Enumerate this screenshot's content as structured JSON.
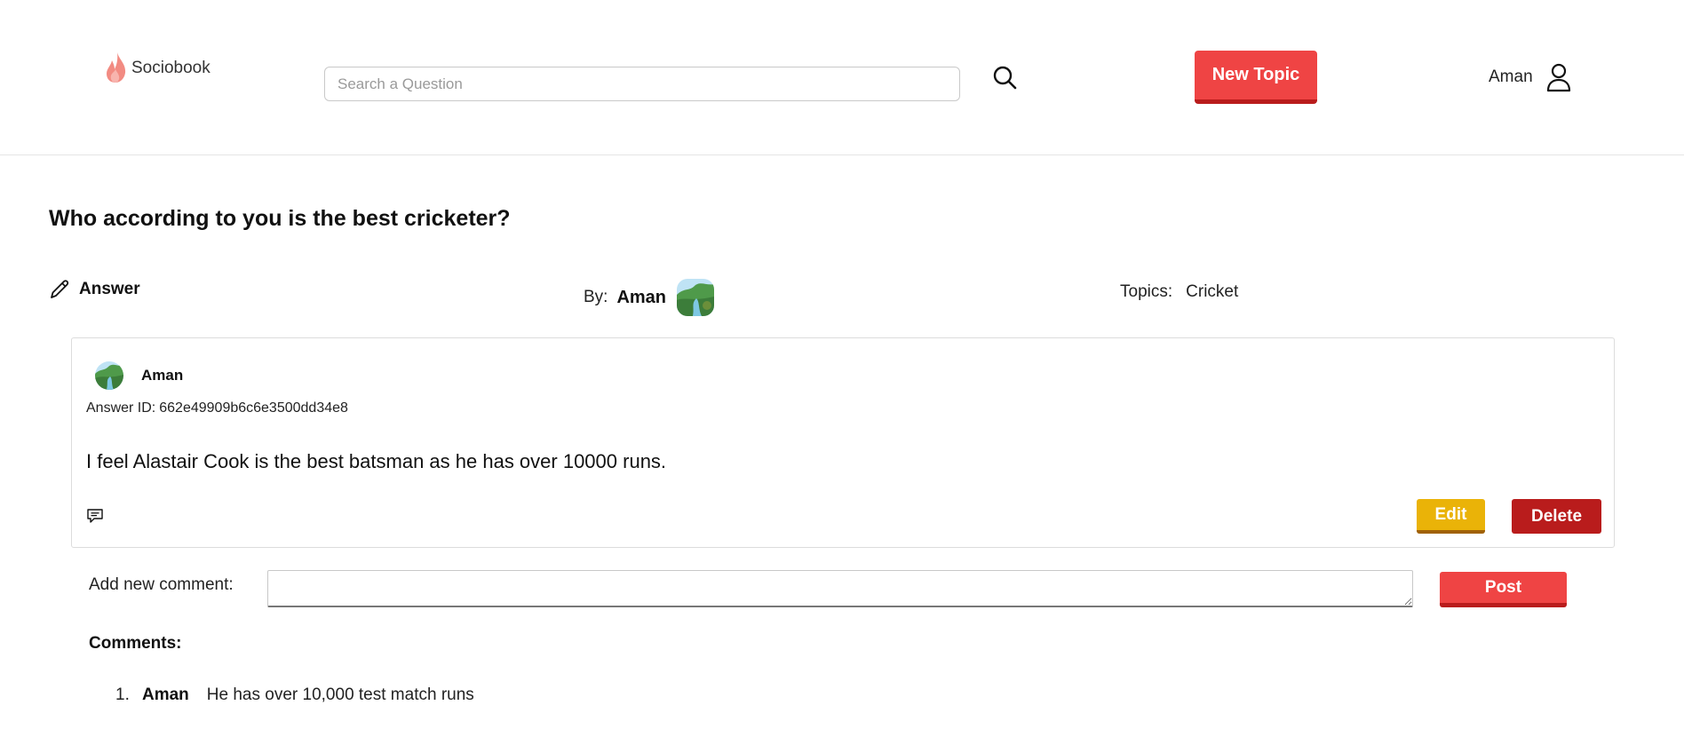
{
  "brand": {
    "name": "Sociobook",
    "accent": "#ef4444"
  },
  "header": {
    "search_placeholder": "Search a Question",
    "new_topic_label": "New Topic",
    "user_name": "Aman"
  },
  "question": {
    "title": "Who according to you is the best cricketer?",
    "answer_label": "Answer",
    "by_label": "By:",
    "by_name": "Aman",
    "topics_label": "Topics:",
    "topic": "Cricket"
  },
  "answer": {
    "author": "Aman",
    "id_label": "Answer ID:",
    "id_value": "662e49909b6c6e3500dd34e8",
    "text": "I feel Alastair Cook is the best batsman as he has over 10000 runs.",
    "edit_label": "Edit",
    "delete_label": "Delete"
  },
  "comment_form": {
    "label": "Add new comment:",
    "value": "",
    "post_label": "Post"
  },
  "comments": {
    "heading": "Comments:",
    "items": [
      {
        "num": "1.",
        "author": "Aman",
        "text": "He has over 10,000 test match runs"
      }
    ]
  },
  "colors": {
    "primary_button": "#ef4444",
    "edit_button": "#eab308",
    "delete_button": "#b91c1c"
  }
}
